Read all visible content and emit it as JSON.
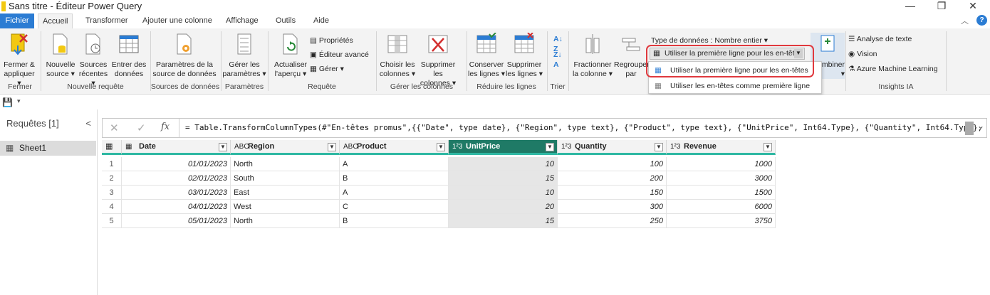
{
  "window": {
    "title": "Sans titre - Éditeur Power Query",
    "minimize": "—",
    "restore": "❐",
    "close": "✕"
  },
  "tabs": [
    "Fichier",
    "Accueil",
    "Transformer",
    "Ajouter une colonne",
    "Affichage",
    "Outils",
    "Aide"
  ],
  "help": "?",
  "ribbon": {
    "close_apply": [
      "Fermer &",
      "appliquer ▾"
    ],
    "new_source": [
      "Nouvelle",
      "source ▾"
    ],
    "recent_sources": [
      "Sources",
      "récentes ▾"
    ],
    "enter_data": [
      "Entrer des",
      "données"
    ],
    "ds_settings": [
      "Paramètres de la",
      "source de données"
    ],
    "manage_params": [
      "Gérer les",
      "paramètres ▾"
    ],
    "refresh": [
      "Actualiser",
      "l'aperçu ▾"
    ],
    "properties": "Propriétés",
    "advanced_editor": "Éditeur avancé",
    "manage": "Gérer ▾",
    "choose_cols": [
      "Choisir les",
      "colonnes ▾"
    ],
    "remove_cols": [
      "Supprimer les",
      "colonnes ▾"
    ],
    "keep_rows": [
      "Conserver",
      "les lignes ▾"
    ],
    "remove_rows": [
      "Supprimer",
      "les lignes ▾"
    ],
    "split_col": [
      "Fractionner",
      "la colonne ▾"
    ],
    "group_by": [
      "Regrouper",
      "par"
    ],
    "data_type": "Type de données : Nombre entier ▾",
    "use_first_row": "Utiliser la première ligne pour les en-têtes",
    "combine": [
      "mbiner",
      "▾"
    ],
    "text_analysis": "Analyse de texte",
    "vision": "Vision",
    "azure_ml": "Azure Machine Learning",
    "groups": [
      "Fermer",
      "Nouvelle requête",
      "Sources de données",
      "Paramètres",
      "Requête",
      "Gérer les colonnes",
      "Réduire les lignes",
      "Trier",
      "Insights IA"
    ]
  },
  "menu": {
    "item1": "Utiliser la première ligne pour les en-têtes",
    "item2": "Utiliser les en-têtes comme première ligne"
  },
  "queries": {
    "header": "Requêtes [1]",
    "collapse": "<",
    "items": [
      "Sheet1"
    ]
  },
  "formula": {
    "cancel": "✕",
    "confirm": "✓",
    "fx": "fx",
    "text": "= Table.TransformColumnTypes(#\"En-têtes promus\",{{\"Date\", type date}, {\"Region\", type text}, {\"Product\", type text}, {\"UnitPrice\", Int64.Type}, {\"Quantity\", Int64.Type},",
    "expand": "⌄"
  },
  "table": {
    "columns": [
      {
        "type": "▦",
        "name": "Date"
      },
      {
        "type": "ABC",
        "name": "Region"
      },
      {
        "type": "ABC",
        "name": "Product"
      },
      {
        "type": "1²3",
        "name": "UnitPrice"
      },
      {
        "type": "1²3",
        "name": "Quantity"
      },
      {
        "type": "1²3",
        "name": "Revenue"
      }
    ],
    "rows": [
      [
        "1",
        "01/01/2023",
        "North",
        "A",
        "10",
        "100",
        "1000"
      ],
      [
        "2",
        "02/01/2023",
        "South",
        "B",
        "15",
        "200",
        "3000"
      ],
      [
        "3",
        "03/01/2023",
        "East",
        "A",
        "10",
        "150",
        "1500"
      ],
      [
        "4",
        "04/01/2023",
        "West",
        "C",
        "20",
        "300",
        "6000"
      ],
      [
        "5",
        "05/01/2023",
        "North",
        "B",
        "15",
        "250",
        "3750"
      ]
    ]
  },
  "colors": {
    "accent": "#2b7cd3",
    "selected_col": "#1f7a66",
    "teal_bar": "#2fb8a3",
    "highlight": "#e0393e"
  }
}
